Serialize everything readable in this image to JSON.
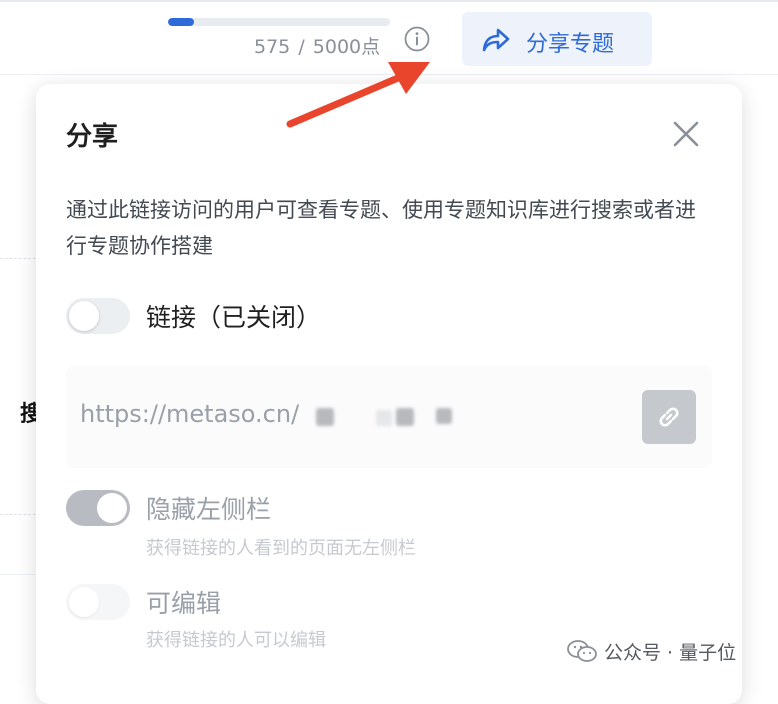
{
  "topbar": {
    "progress": {
      "used": 575,
      "total": 5000,
      "fraction": 0.115
    },
    "points_used": "575",
    "points_sep": "/",
    "points_total": "5000点",
    "share_topic_label": "分享专题"
  },
  "dialog": {
    "title": "分享",
    "description": "通过此链接访问的用户可查看专题、使用专题知识库进行搜索或者进行专题协作搭建",
    "link_toggle": {
      "label": "链接（已关闭）",
      "on": false
    },
    "url_text": "https://metaso.cn/",
    "options": [
      {
        "label": "隐藏左侧栏",
        "sub": "获得链接的人看到的页面无左侧栏",
        "on": true
      },
      {
        "label": "可编辑",
        "sub": "获得链接的人可以编辑",
        "on": false
      }
    ]
  },
  "background": {
    "left_char": "搜"
  },
  "watermark": {
    "text": "公众号 · 量子位"
  },
  "colors": {
    "accent": "#2f6bd8",
    "arrow": "#e8452c"
  }
}
